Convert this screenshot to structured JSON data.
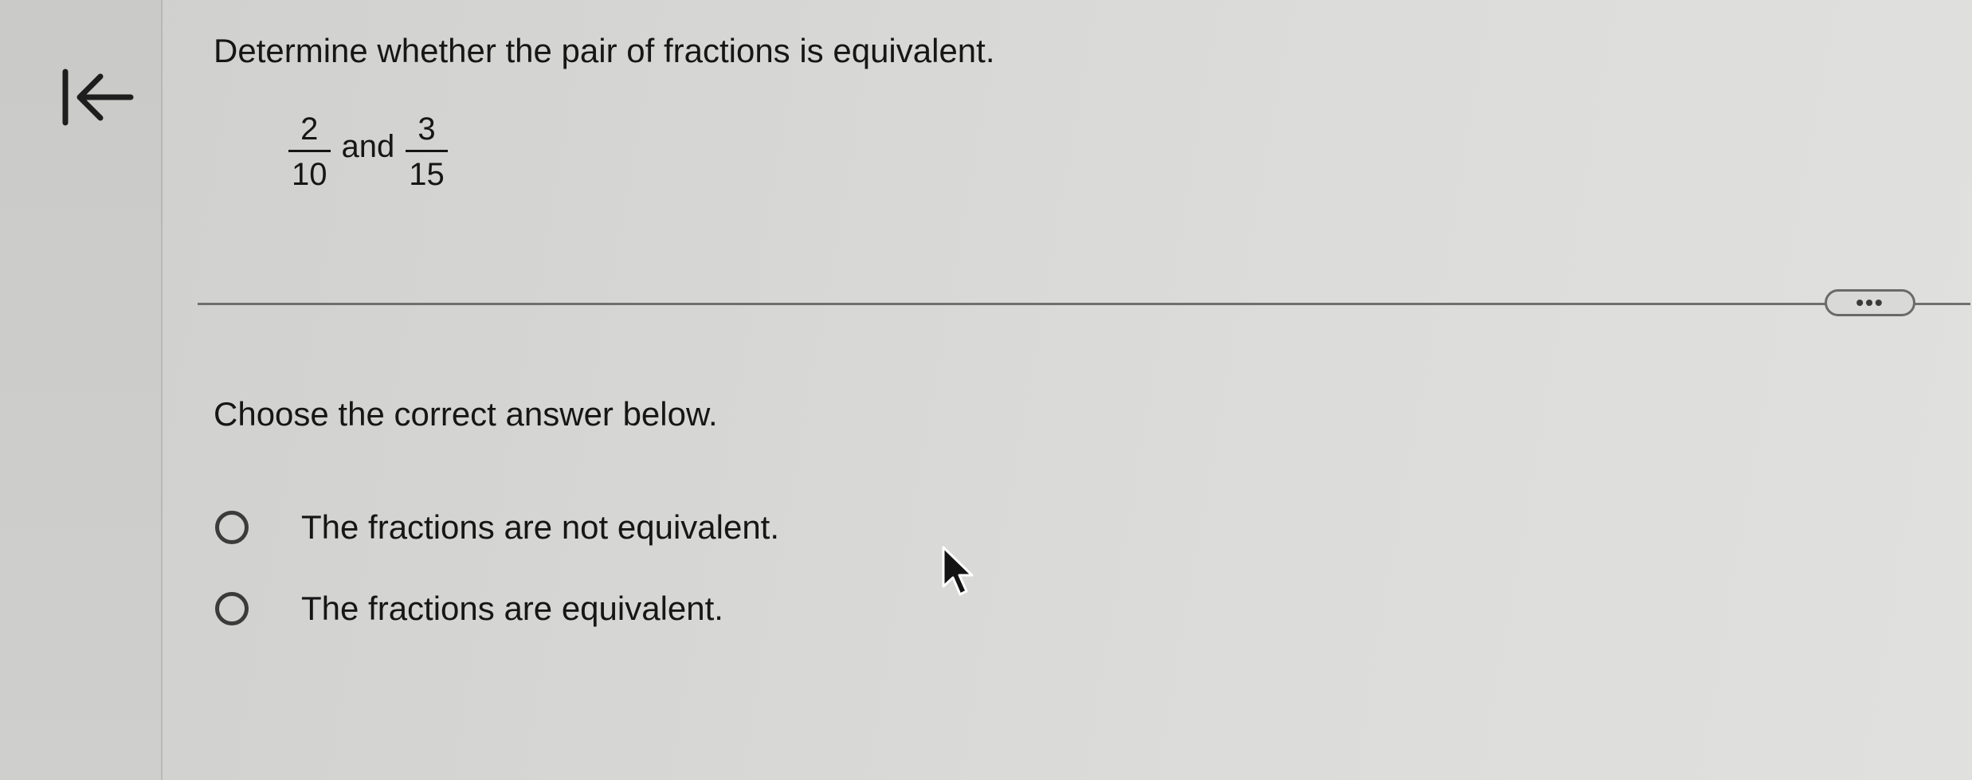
{
  "question": {
    "text": "Determine whether the pair of fractions is equivalent.",
    "fraction_a": {
      "numerator": "2",
      "denominator": "10"
    },
    "conjunction": "and",
    "fraction_b": {
      "numerator": "3",
      "denominator": "15"
    }
  },
  "more_button": {
    "label": "•••"
  },
  "answer": {
    "prompt": "Choose the correct answer below.",
    "options": [
      {
        "label": "The fractions are not equivalent.",
        "selected": false
      },
      {
        "label": "The fractions are equivalent.",
        "selected": false
      }
    ]
  },
  "icons": {
    "back": "first-page-icon",
    "cursor": "mouse-pointer-icon"
  },
  "colors": {
    "text": "#161616",
    "divider": "#6f6f6d",
    "radio_border": "#3b3b3b"
  }
}
